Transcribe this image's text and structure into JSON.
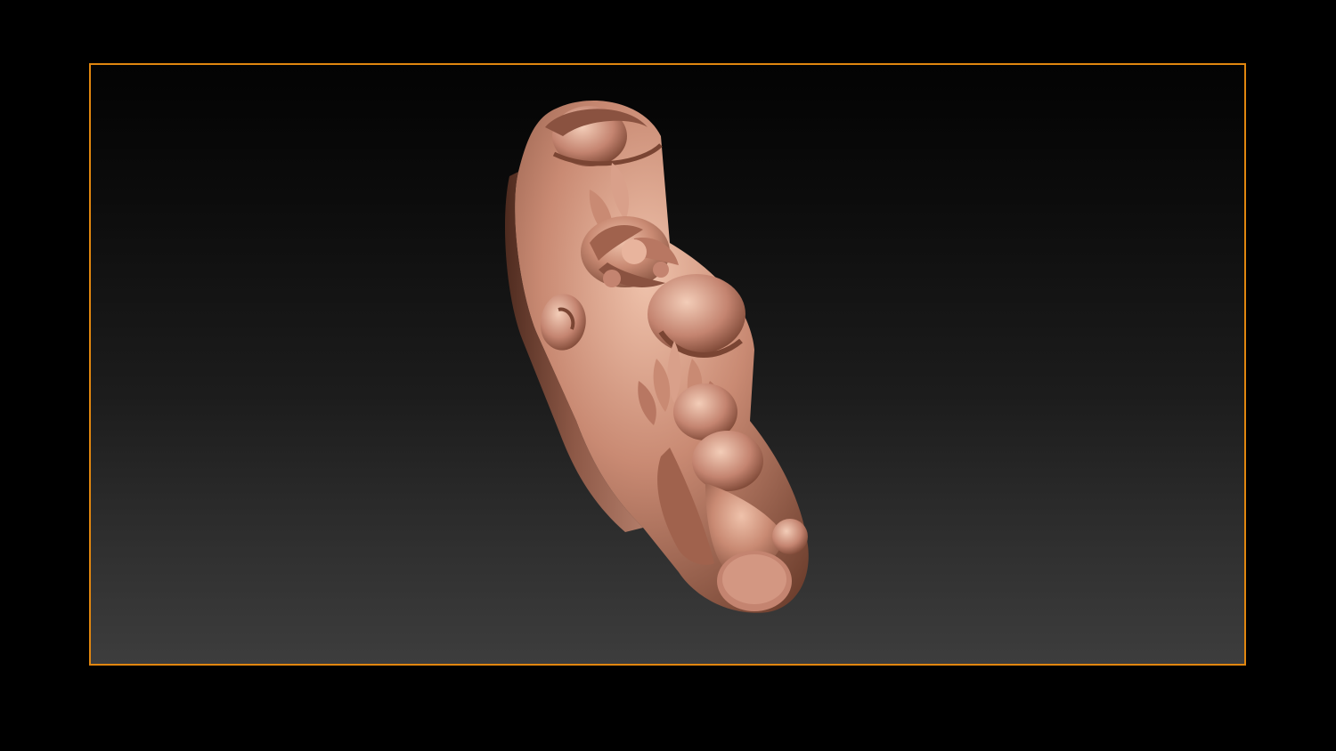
{
  "window": {
    "frame_color": "#e0860f",
    "background_top": "#030303",
    "background_bottom": "#3d3d3d"
  },
  "canvas": {
    "model": {
      "kind": "carved-ornamental-leg-sculpt",
      "material_color": "#c98a73",
      "shadow_color": "#6e3f2e",
      "highlight_color": "#efc2ab"
    }
  }
}
